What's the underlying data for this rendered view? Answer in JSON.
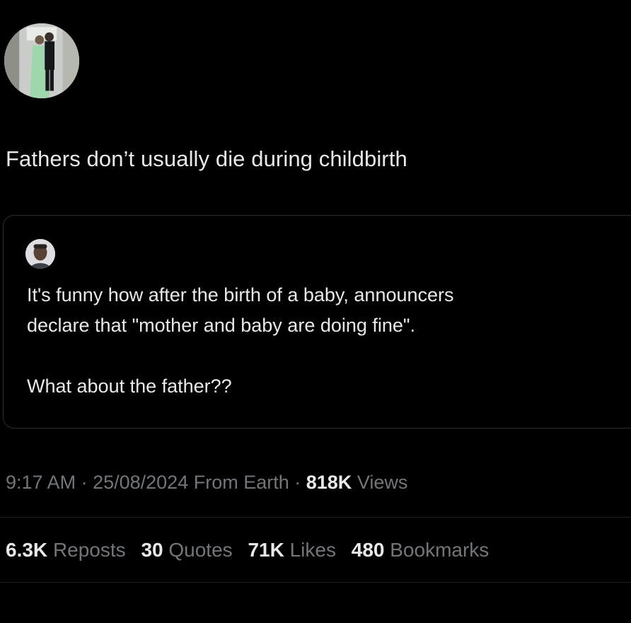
{
  "tweet": {
    "text": "Fathers don’t usually die during childbirth"
  },
  "quoted_tweet": {
    "line1": "It's funny how after the birth of a baby, announcers",
    "line2": "declare that \"mother and baby are doing fine\".",
    "line3": "What about the father??"
  },
  "meta": {
    "time": "9:17 AM",
    "separator": " · ",
    "date": "25/08/2024",
    "source": "From Earth",
    "views_count": "818K",
    "views_label": "Views"
  },
  "stats": [
    {
      "count": "6.3K",
      "label": "Reposts"
    },
    {
      "count": "30",
      "label": "Quotes"
    },
    {
      "count": "71K",
      "label": "Likes"
    },
    {
      "count": "480",
      "label": "Bookmarks"
    }
  ],
  "colors": {
    "background": "#000000",
    "text_primary": "#e7e9ea",
    "text_secondary": "#71767b",
    "border": "#2a2d30"
  }
}
